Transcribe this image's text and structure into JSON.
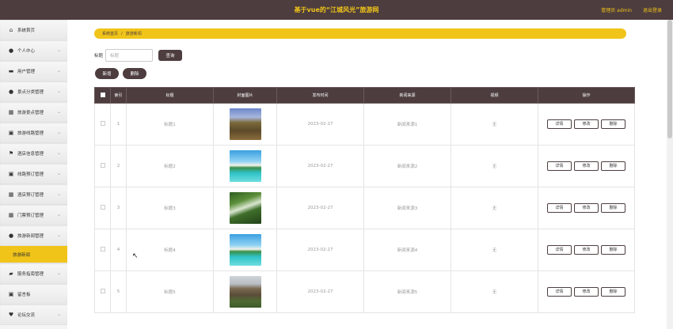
{
  "header": {
    "title": "基于vue的“江城风光”旅游网",
    "admin_label": "管理员 admin",
    "logout_label": "退出登录"
  },
  "sidebar": {
    "items": [
      {
        "label": "系统首页",
        "icon": "home-icon",
        "glyph": "⌂",
        "expandable": false
      },
      {
        "label": "个人中心",
        "icon": "user-icon",
        "glyph": "●",
        "expandable": true
      },
      {
        "label": "用户管理",
        "icon": "folder-icon",
        "glyph": "▬",
        "expandable": true
      },
      {
        "label": "景点分类管理",
        "icon": "user-icon",
        "glyph": "●",
        "expandable": true
      },
      {
        "label": "旅游景点管理",
        "icon": "grid-icon",
        "glyph": "▦",
        "expandable": true
      },
      {
        "label": "旅游线路管理",
        "icon": "box-icon",
        "glyph": "▣",
        "expandable": true
      },
      {
        "label": "酒店信息管理",
        "icon": "flag-icon",
        "glyph": "⚑",
        "expandable": true
      },
      {
        "label": "线路预订管理",
        "icon": "box-icon",
        "glyph": "▣",
        "expandable": true
      },
      {
        "label": "酒店预订管理",
        "icon": "grid-icon",
        "glyph": "▦",
        "expandable": true
      },
      {
        "label": "门票预订管理",
        "icon": "grid-icon",
        "glyph": "▦",
        "expandable": true
      },
      {
        "label": "旅游新闻管理",
        "icon": "user-icon",
        "glyph": "●",
        "expandable": true
      },
      {
        "label": "旅游新闻",
        "icon": "",
        "glyph": "",
        "expandable": false,
        "active": true
      },
      {
        "label": "服务指南管理",
        "icon": "chat-icon",
        "glyph": "▰",
        "expandable": true
      },
      {
        "label": "留言板",
        "icon": "box-icon",
        "glyph": "▣",
        "expandable": false
      },
      {
        "label": "论坛交流",
        "icon": "heart-icon",
        "glyph": "♥",
        "expandable": true
      }
    ]
  },
  "breadcrumb": {
    "home": "系统首页",
    "separator": "/",
    "current": "旅游新闻"
  },
  "search": {
    "label": "标题",
    "placeholder": "标题",
    "button": "查询"
  },
  "actions": {
    "add": "新增",
    "delete": "删除"
  },
  "table": {
    "headers": [
      "索引",
      "标题",
      "封面图片",
      "发布时间",
      "新闻来源",
      "视频",
      "操作"
    ],
    "rows": [
      {
        "index": "1",
        "title": "标题1",
        "image": "mountain-road",
        "date": "2023-02-27",
        "source": "新闻来源1",
        "video": "无"
      },
      {
        "index": "2",
        "title": "标题2",
        "image": "tropical-beach",
        "date": "2023-02-27",
        "source": "新闻来源2",
        "video": "无"
      },
      {
        "index": "3",
        "title": "标题3",
        "image": "forest-waterfall",
        "date": "2023-02-27",
        "source": "新闻来源3",
        "video": "无"
      },
      {
        "index": "4",
        "title": "标题4",
        "image": "tropical-beach",
        "date": "2023-02-27",
        "source": "新闻来源4",
        "video": "无"
      },
      {
        "index": "5",
        "title": "标题5",
        "image": "stone-tower",
        "date": "2023-02-27",
        "source": "新闻来源5",
        "video": "无"
      }
    ],
    "op_labels": {
      "detail": "详情",
      "edit": "修改",
      "delete": "删除"
    }
  },
  "colors": {
    "header_bg": "#4d3d3e",
    "accent": "#f0c419",
    "sidebar_bg": "#f4f4f4"
  }
}
